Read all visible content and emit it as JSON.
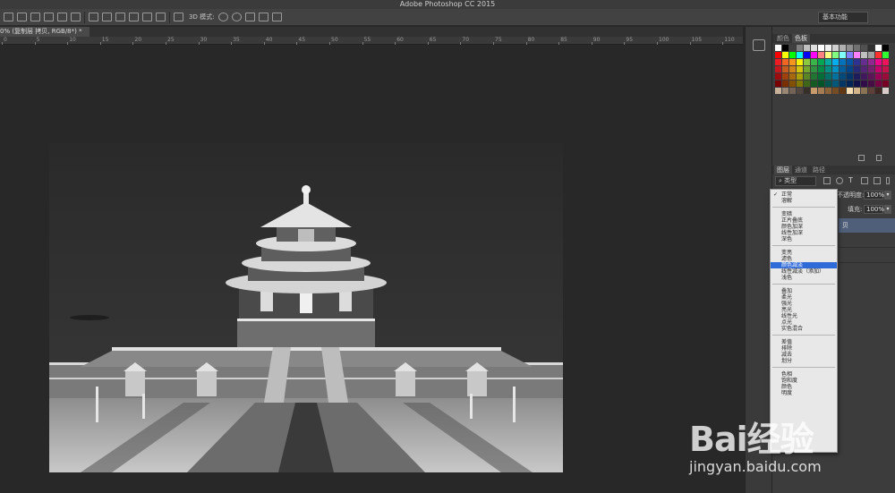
{
  "window": {
    "title": "Adobe Photoshop CC 2015"
  },
  "options_bar": {
    "mode_label": "3D 模式:",
    "workspace": "基本功能"
  },
  "document": {
    "tab_label": "0% (复制层 拷贝, RGB/8*) *"
  },
  "ruler": {
    "labels": [
      "0",
      "5",
      "10",
      "15",
      "20",
      "25",
      "30",
      "35",
      "40",
      "45",
      "50",
      "55",
      "60",
      "65",
      "70",
      "75",
      "80",
      "85",
      "90",
      "95",
      "100",
      "105",
      "110"
    ]
  },
  "swatches_panel": {
    "tabs": [
      "颜色",
      "色板"
    ],
    "active_tab": "色板"
  },
  "layers_panel": {
    "tabs": [
      "图层",
      "通道",
      "路径"
    ],
    "active_tab": "图层",
    "kind_filter": "类型",
    "opacity_label": "不透明度:",
    "opacity_value": "100%",
    "fill_label": "填充:",
    "fill_value": "100%",
    "selected_layer_fragment": "贝"
  },
  "blend_menu": {
    "checked": "正常",
    "highlighted": "颜色减淡",
    "groups": [
      [
        "正常",
        "溶解"
      ],
      [
        "变暗",
        "正片叠底",
        "颜色加深",
        "线性加深",
        "深色"
      ],
      [
        "变亮",
        "滤色",
        "颜色减淡",
        "线性减淡（添加）",
        "浅色"
      ],
      [
        "叠加",
        "柔光",
        "强光",
        "亮光",
        "线性光",
        "点光",
        "实色混合"
      ],
      [
        "差值",
        "排除",
        "减去",
        "划分"
      ],
      [
        "色相",
        "饱和度",
        "颜色",
        "明度"
      ]
    ]
  },
  "colors": {
    "app_bg": "#282828",
    "panel_bg": "#3c3c3c",
    "menu_highlight": "#2f6ad9"
  },
  "watermark": {
    "logo": "Bai经验",
    "url": "jingyan.baidu.com"
  }
}
